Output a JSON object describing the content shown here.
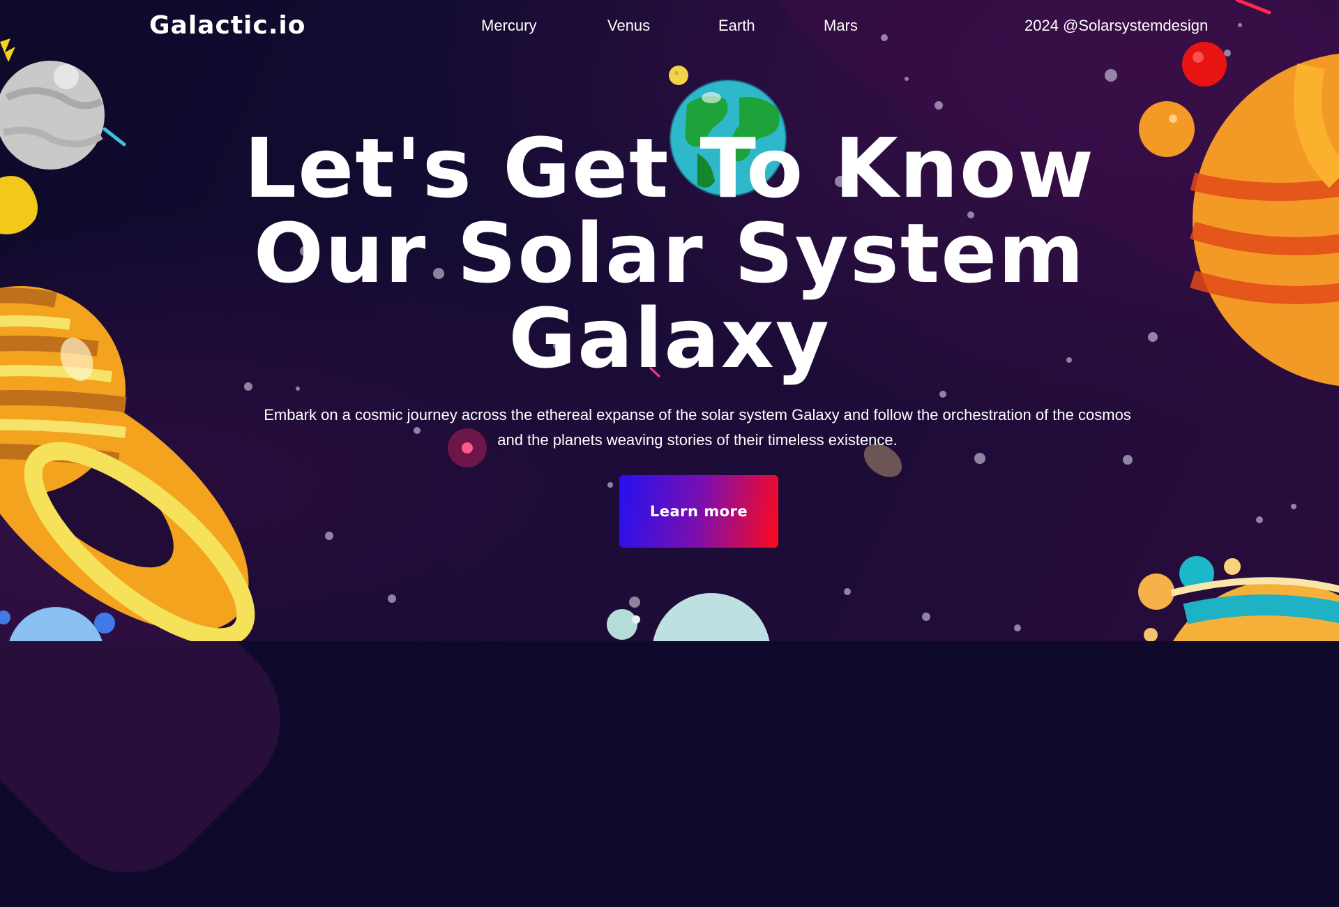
{
  "header": {
    "logo": "Galactic.io",
    "nav": [
      "Mercury",
      "Venus",
      "Earth",
      "Mars"
    ],
    "credit": "2024 @Solarsystemdesign"
  },
  "hero": {
    "title_lines": [
      "Let's Get To Know",
      "Our Solar System",
      "Galaxy"
    ],
    "subtitle_line1": "Embark on a cosmic journey across the ethereal expanse of the solar system Galaxy and follow the orchestration of the cosmos",
    "subtitle_line2": "and the planets weaving stories of their timeless existence.",
    "cta_label": "Learn more"
  },
  "colors": {
    "background": "#0f0a2c",
    "cta_gradient_start": "#2410f0",
    "cta_gradient_end": "#ff0a1c",
    "text": "#ffffff"
  },
  "icons": [
    "mercury-planet",
    "earth-planet",
    "saturn-planet",
    "mars-planet",
    "jupiter-planet",
    "comet",
    "stars"
  ]
}
